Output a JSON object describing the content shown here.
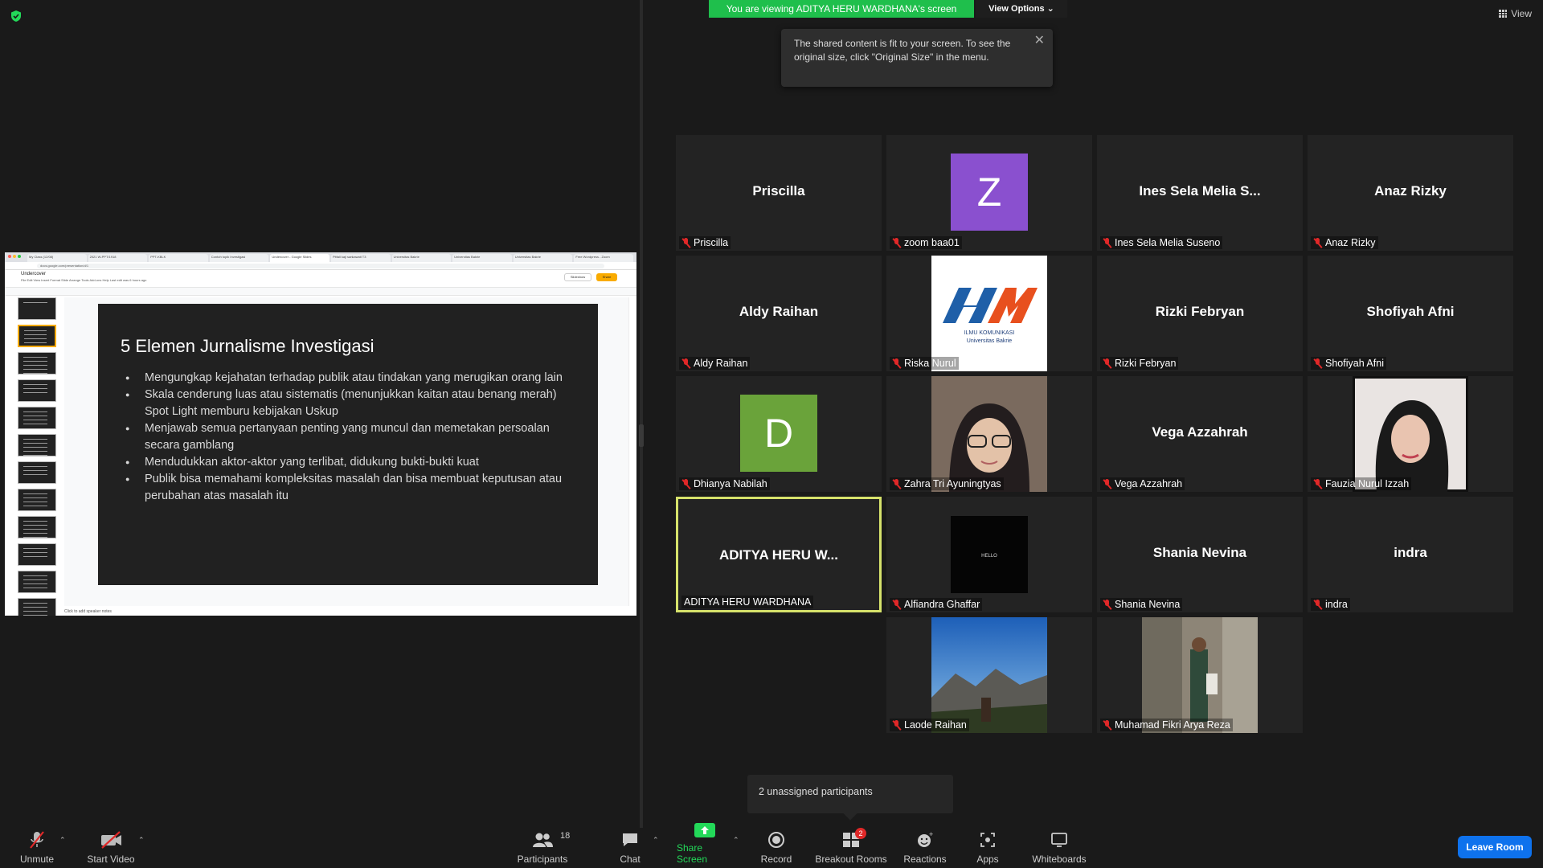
{
  "banner": {
    "text": "You are viewing ADITYA HERU WARDHANA's screen",
    "view_options": "View Options ⌄"
  },
  "view_button": "View",
  "tooltip": {
    "text": "The shared content is fit to your screen. To see the original size, click \"Original Size\" in the menu."
  },
  "shared_screen": {
    "tabs": [
      "My Class (12/08)",
      "2021 W-PPT/1918",
      "PPT-KBLK",
      "Contoh topik Investigasi",
      "Undercover - Google Slides",
      "Pitfall kaji sankawati T3",
      "Universitas Bakrie",
      "Universitas Bakrie",
      "Universitas Bakrie",
      "Free Wordpress - Zoom"
    ],
    "address": "docs.google.com/presentation/d/1",
    "doc_title": "Undercover",
    "doc_menu": "File  Edit  View  Insert  Format  Slide  Arrange  Tools  Add-ons  Help   Last edit was 6 hours ago",
    "slideshow": "Slideshow",
    "share": "Share",
    "notes": "Click to add speaker notes",
    "slide": {
      "title": "5 Elemen Jurnalisme Investigasi",
      "bullets": [
        "Mengungkap kejahatan terhadap publik atau tindakan yang merugikan orang lain",
        "Skala cenderung luas atau sistematis (menunjukkan kaitan atau benang merah) Spot Light memburu kebijakan Uskup",
        "Menjawab semua pertanyaan penting yang muncul dan memetakan persoalan secara gamblang",
        "Mendudukkan aktor-aktor yang terlibat, didukung bukti-bukti kuat",
        "Publik bisa memahami kompleksitas masalah dan bisa membuat keputusan atau perubahan atas masalah itu"
      ]
    }
  },
  "participants": [
    {
      "big": "Priscilla",
      "label": "Priscilla",
      "muted": true
    },
    {
      "big": "",
      "letter": "Z",
      "letter_color": "#8a50cf",
      "label": "zoom baa01",
      "muted": true
    },
    {
      "big": "Ines Sela Melia S...",
      "label": "Ines Sela Melia Suseno",
      "muted": true
    },
    {
      "big": "Anaz Rizky",
      "label": "Anaz Rizky",
      "muted": true
    },
    {
      "big": "Aldy Raihan",
      "label": "Aldy Raihan",
      "muted": true
    },
    {
      "big": "",
      "photo": "logo",
      "logo_text": "ILMU KOMUNIKASI",
      "logo_sub": "Universitas Bakrie",
      "label": "Riska Nurul",
      "muted": true
    },
    {
      "big": "Rizki Febryan",
      "label": "Rizki Febryan",
      "muted": true
    },
    {
      "big": "Shofiyah Afni",
      "label": "Shofiyah Afni",
      "muted": true
    },
    {
      "big": "",
      "letter": "D",
      "letter_color": "#6aa33a",
      "label": "Dhianya Nabilah",
      "muted": true
    },
    {
      "big": "",
      "photo": "face1",
      "label": "Zahra Tri Ayuningtyas",
      "muted": true
    },
    {
      "big": "Vega Azzahrah",
      "label": "Vega Azzahrah",
      "muted": true
    },
    {
      "big": "",
      "photo": "face2",
      "label": "Fauzia Nurul Izzah",
      "muted": true
    },
    {
      "big": "ADITYA HERU W...",
      "label": "ADITYA HERU WARDHANA",
      "muted": false,
      "active": true
    },
    {
      "big": "",
      "photo": "hello",
      "hello_text": "HELLO",
      "label": "Alfiandra Ghaffar",
      "muted": true
    },
    {
      "big": "Shania Nevina",
      "label": "Shania Nevina",
      "muted": true
    },
    {
      "big": "indra",
      "label": "indra",
      "muted": true
    },
    {
      "big": "",
      "photo": "mountain",
      "label": "Laode Raihan",
      "muted": true
    },
    {
      "big": "",
      "photo": "street",
      "label": "Muhamad Fikri Arya Reza",
      "muted": true
    }
  ],
  "unassigned": "2 unassigned participants",
  "toolbar": {
    "unmute": "Unmute",
    "start_video": "Start Video",
    "participants": "Participants",
    "participants_count": "18",
    "chat": "Chat",
    "share_screen": "Share Screen",
    "record": "Record",
    "breakout_rooms": "Breakout Rooms",
    "breakout_count": "2",
    "reactions": "Reactions",
    "apps": "Apps",
    "whiteboards": "Whiteboards",
    "leave_room": "Leave Room"
  },
  "colors": {
    "accent_green": "#23d959",
    "leave_blue": "#0e72ed",
    "muted_red": "#e02828",
    "active_border": "#d6e26b"
  }
}
